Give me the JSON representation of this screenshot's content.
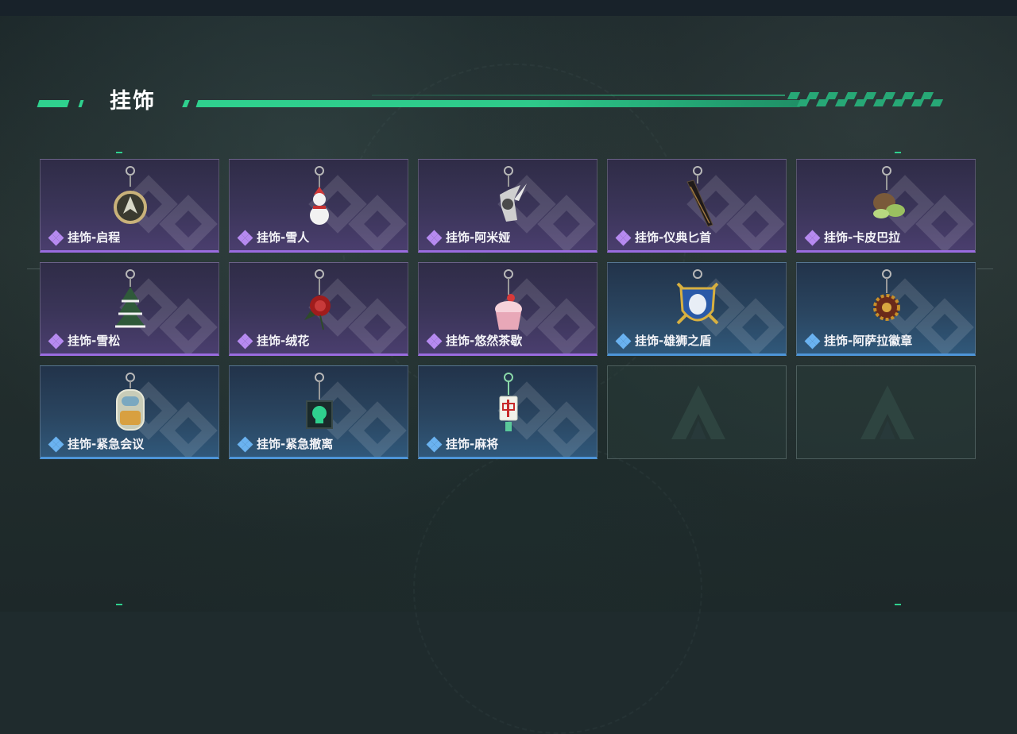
{
  "section": {
    "title": "挂饰"
  },
  "colors": {
    "accent": "#2fd18e",
    "purple_rarity": "#9a6ce0",
    "blue_rarity": "#4d95d8"
  },
  "items": [
    {
      "label": "挂饰-启程",
      "rarity": "purple",
      "icon": "compass-charm-icon"
    },
    {
      "label": "挂饰-雪人",
      "rarity": "purple",
      "icon": "snowman-charm-icon"
    },
    {
      "label": "挂饰-阿米娅",
      "rarity": "purple",
      "icon": "amiya-charm-icon"
    },
    {
      "label": "挂饰-仪典匕首",
      "rarity": "purple",
      "icon": "dagger-charm-icon"
    },
    {
      "label": "挂饰-卡皮巴拉",
      "rarity": "purple",
      "icon": "capybara-charm-icon"
    },
    {
      "label": "挂饰-雪松",
      "rarity": "purple",
      "icon": "pine-tree-charm-icon"
    },
    {
      "label": "挂饰-绒花",
      "rarity": "purple",
      "icon": "rose-charm-icon"
    },
    {
      "label": "挂饰-悠然茶歇",
      "rarity": "purple",
      "icon": "cupcake-charm-icon"
    },
    {
      "label": "挂饰-雄狮之盾",
      "rarity": "blue",
      "icon": "lion-shield-charm-icon"
    },
    {
      "label": "挂饰-阿萨拉徽章",
      "rarity": "blue",
      "icon": "badge-charm-icon"
    },
    {
      "label": "挂饰-紧急会议",
      "rarity": "blue",
      "icon": "astronaut-charm-icon"
    },
    {
      "label": "挂饰-紧急撤离",
      "rarity": "blue",
      "icon": "skull-cube-charm-icon"
    },
    {
      "label": "挂饰-麻将",
      "rarity": "blue",
      "icon": "mahjong-charm-icon"
    }
  ],
  "empty_slots": 2
}
